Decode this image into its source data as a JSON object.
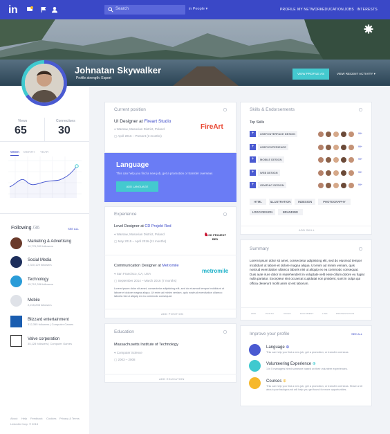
{
  "topbar": {
    "logo": "in",
    "search_placeholder": "Search",
    "filter": "in People",
    "nav": [
      "PROFILE",
      "MY NETWORK",
      "EDUCATION",
      "JOBS",
      "INTERESTS"
    ]
  },
  "profile": {
    "name": "Johnatan Skywalker",
    "strength": "Profile strength: Expert",
    "view_as": "VIEW PROFILE AS",
    "recent": "VIEW RECENT ACTIVITY"
  },
  "stats": {
    "views_label": "Views",
    "views": "65",
    "connections_label": "Connections",
    "connections": "30",
    "tabs": [
      "WEEK",
      "MONTH",
      "YEAR"
    ]
  },
  "following": {
    "title": "Following",
    "count": "/36",
    "see_all": "SEE ALL",
    "items": [
      {
        "name": "Marketing & Advertising",
        "sub": "10,776,399 followers",
        "color": "#6a3a2a"
      },
      {
        "name": "Social Media",
        "sub": "2,320,129 followers",
        "color": "#1d2f5c"
      },
      {
        "name": "Technology",
        "sub": "15,712,338 followers",
        "color": "#2a9cd8"
      },
      {
        "name": "Mobile",
        "sub": "2,215,298 followers",
        "color": "#dfe2e8"
      },
      {
        "name": "Blizzard entertainment",
        "sub": "312,355 followers | Computer Games",
        "color": "#1a5db0"
      },
      {
        "name": "Valve corporation",
        "sub": "35,128 followers | Computer Games",
        "color": "#333"
      }
    ]
  },
  "footer": [
    "About",
    "Help",
    "Feedback",
    "Cookies",
    "Privacy & Terms"
  ],
  "copyright": "LinkedIn Corp. © 2015",
  "current": {
    "title": "Current position",
    "role": "UI Designer at ",
    "company": "Fireart Studio",
    "location": "Warsaw, Masovian District, Poland",
    "dates": "April 2016 – Present (3 months)",
    "logo": "FireArt"
  },
  "language": {
    "title": "Language",
    "text": "This can help you find a new job, get a promotion or transfer overseas",
    "button": "ADD LANGUAGE"
  },
  "experience": {
    "title": "Experience",
    "items": [
      {
        "role": "Level Designer at ",
        "company": "CD Projekt Red",
        "location": "Warsaw, Masovian District, Poland",
        "dates": "May 2015 – April 2016 (11 months)",
        "logo": "CD PROJEKT RED"
      },
      {
        "role": "Communication Designer at ",
        "company": "Metromile",
        "location": "San Francisco, CA, USA",
        "dates": "September 2014 – March 2016 (7 months)",
        "logo": "metromile",
        "desc": "Lorem ipsum dolor sit amet, consectetur adipisicing elit, sed do eiusmod tempor incididunt ut labore et dolore magna aliqua. Ut enim ad minim veniam, quis nostrud exercitation ullamco laboris nisi ut aliquip ex ea commodo consequat."
      }
    ],
    "add": "ADD POSITION"
  },
  "education": {
    "title": "Education",
    "school": "Massachusetts Institute of Technology",
    "field": "Computer Science",
    "dates": "2003 – 2008",
    "add": "ADD EDUCATION"
  },
  "skills": {
    "title": "Skills & Endorsements",
    "top": "Top Skills",
    "items": [
      "USER INTERFACE DESIGN",
      "USER EXPERIENCE",
      "MOBILE DESIGN",
      "WEB DESIGN",
      "GRAPHIC DESIGN"
    ],
    "more_badge": "99+",
    "tags": [
      "HTML",
      "ILLUSTRATION",
      "INDESIGN",
      "PHOTOGRAPHY",
      "LOGO DESIGN",
      "BRANDING"
    ],
    "add": "ADD SKILL"
  },
  "summary": {
    "title": "Summary",
    "text": "Lorem ipsum dolor sit amet, consectetur adipisicing elit, sed do eiusmod tempor incididunt ut labore et dolore magna aliqua. Ut enim ad minim veniam, quis nostrud exercitation ullamco laboris nisi ut aliquip ex ea commodo consequat. Duis aute irure dolor in reprehenderit in voluptate velit esse cillum dolore eu fugiat nulla pariatur. Excepteur sint occaecat cupidatat non proident, sunt in culpa qui officia deserunt mollit anim id est laborum.",
    "actions": [
      "ADD",
      "PHOTO",
      "VIDEO",
      "DOCUMENT",
      "LINK",
      "PRESENTATION"
    ]
  },
  "improve": {
    "title": "Improve your profile",
    "see_all": "SEE ALL",
    "items": [
      {
        "name": "Language",
        "text": "This can help you find a new job, get a promotion, or transfer overseas",
        "color": "#4a5ad1"
      },
      {
        "name": "Volunteering Experience",
        "text": "1 in 5 managers hired someone based on their volunteer experiences.",
        "color": "#3fc9cf"
      },
      {
        "name": "Courses",
        "text": "This can help you find a new job, get a promotion, or transfer overseas. Share a bit about your background will help you get found for more opportunities.",
        "color": "#f6b82b"
      }
    ]
  },
  "colors": {
    "brand": "#3a48c7",
    "accent": "#44c9cf",
    "language_card": "#6a7cf5"
  }
}
